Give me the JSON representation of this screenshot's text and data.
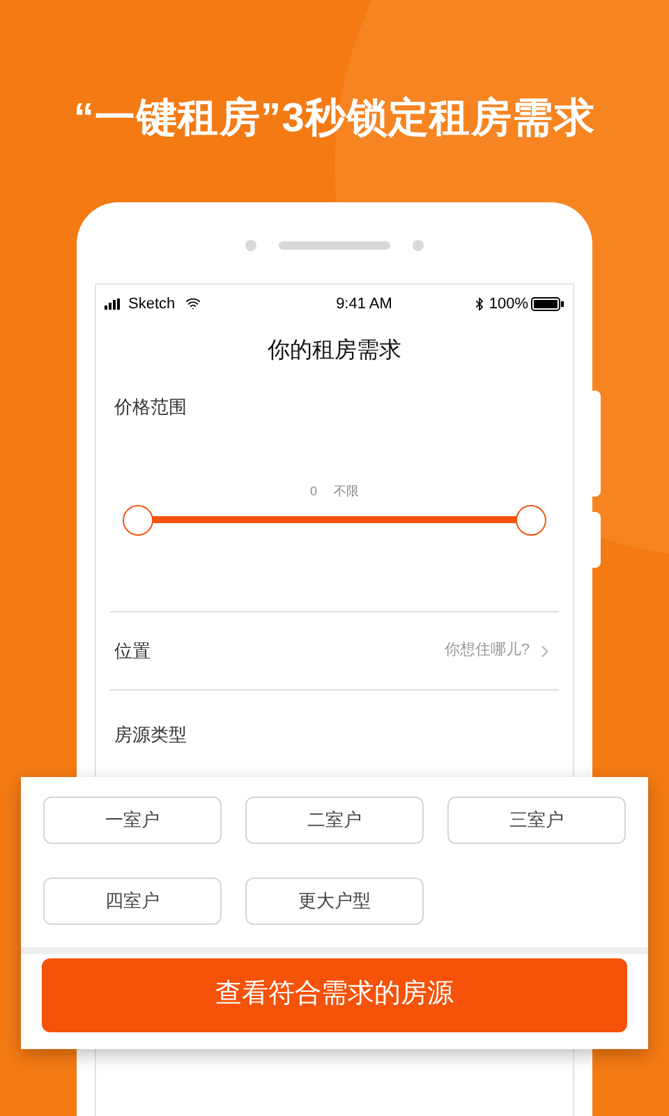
{
  "headline": "“一键租房”3秒锁定租房需求",
  "status_bar": {
    "carrier": "Sketch",
    "time": "9:41 AM",
    "battery": "100%"
  },
  "screen_title": "你的租房需求",
  "price": {
    "label": "价格范围",
    "reading_min": "0",
    "reading_max": "不限",
    "level": 1
  },
  "location": {
    "label": "位置",
    "placeholder": "你想住哪儿?"
  },
  "room_type": {
    "label": "房源类型"
  },
  "room_options": [
    {
      "label": "一室户",
      "selected": false
    },
    {
      "label": "二室户",
      "selected": false
    },
    {
      "label": "三室户",
      "selected": false
    },
    {
      "label": "四室户",
      "selected": false
    },
    {
      "label": "更大户型",
      "selected": false
    }
  ],
  "submit": "查看符合需求的房源"
}
